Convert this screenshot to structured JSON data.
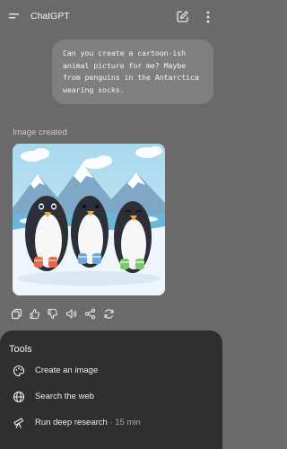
{
  "header": {
    "title": "ChatGPT",
    "menu_icon": "menu-icon",
    "edit_icon": "new-chat-icon",
    "more_icon": "more-vertical-icon"
  },
  "conversation": {
    "user_message": "Can you create a cartoon-ish animal picture for me? Maybe from penguins in the Antarctica wearing socks.",
    "image_status": "Image created",
    "image_subject": "three cartoon penguins wearing socks on snow",
    "sock_colors": [
      "#e8694a",
      "#6fa8dc",
      "#7bc96f"
    ],
    "action_icons": [
      "copy-icon",
      "thumbs-up-icon",
      "thumbs-down-icon",
      "speaker-icon",
      "share-icon",
      "regenerate-icon"
    ]
  },
  "tools": {
    "title": "Tools",
    "items": [
      {
        "label": "Create an image",
        "meta": "",
        "icon": "palette-icon"
      },
      {
        "label": "Search the web",
        "meta": "",
        "icon": "globe-icon"
      },
      {
        "label": "Run deep research",
        "meta": " · 15 min",
        "icon": "telescope-icon"
      }
    ]
  },
  "colors": {
    "background": "#6a6a6a",
    "bubble": "#7f7f7f",
    "sheet": "#2f2f2f"
  }
}
